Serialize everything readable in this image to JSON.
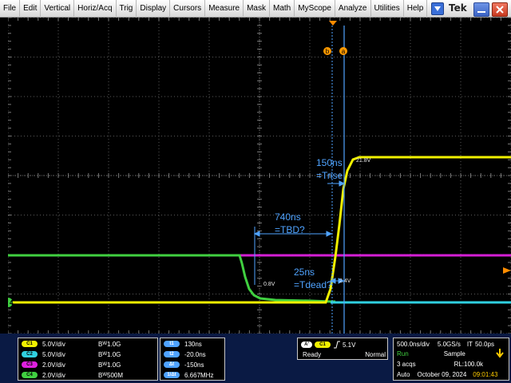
{
  "menu": {
    "items": [
      "File",
      "Edit",
      "Vertical",
      "Horiz/Acq",
      "Trig",
      "Display",
      "Cursors",
      "Measure",
      "Mask",
      "Math",
      "MyScope",
      "Analyze",
      "Utilities",
      "Help"
    ]
  },
  "brand": "Tek",
  "cursor_tags": {
    "b": "b",
    "a": "a"
  },
  "annotations": {
    "rise_time": "150ns",
    "rise_name": "=Trise",
    "tbd_time": "740ns",
    "tbd_name": "=TBD?",
    "dead_time": "25ns",
    "dead_name": "=Tdead?",
    "level_low": "0.8V",
    "level_high": "2.4V",
    "level_top": "21.8V"
  },
  "ground_marker": "4",
  "channels": [
    {
      "id": "C1",
      "scale": "5.0V/div",
      "bw": "1.0G",
      "color": "#f0f000"
    },
    {
      "id": "C2",
      "scale": "5.0V/div",
      "bw": "1.0G",
      "color": "#30d0e0"
    },
    {
      "id": "C3",
      "scale": "2.0V/div",
      "bw": "1.0G",
      "color": "#e020e0"
    },
    {
      "id": "C4",
      "scale": "2.0V/div",
      "bw": "500M",
      "color": "#40d040"
    }
  ],
  "bw_prefix": "B",
  "bw_sub": "W",
  "cursor_readouts": [
    {
      "label": "t1",
      "value": "130ns"
    },
    {
      "label": "t2",
      "value": "-20.0ns"
    },
    {
      "label": "Δt",
      "value": "-150ns"
    },
    {
      "label": "1/Δt",
      "value": "6.667MHz"
    }
  ],
  "trigger": {
    "mode_label": "A'",
    "channel": "C1",
    "level": "5.1V",
    "status": "Ready",
    "type": "Normal"
  },
  "acquisition": {
    "horiz_scale": "500.0ns/div",
    "sample_rate": "5.0GS/s",
    "it_label": "IT",
    "it_value": "50.0ps",
    "state": "Run",
    "mode": "Sample",
    "acqs": "3 acqs",
    "record_length": "RL:100.0k",
    "auto_label": "Auto",
    "date": "October 09, 2024",
    "time": "09:01:43"
  },
  "colors": {
    "ch1": "#f0f000",
    "ch2": "#30d0e0",
    "ch3": "#e020e0",
    "ch4": "#40d040",
    "cursor": "#4fa3ff",
    "trigger_marker": "#ff8c00"
  }
}
